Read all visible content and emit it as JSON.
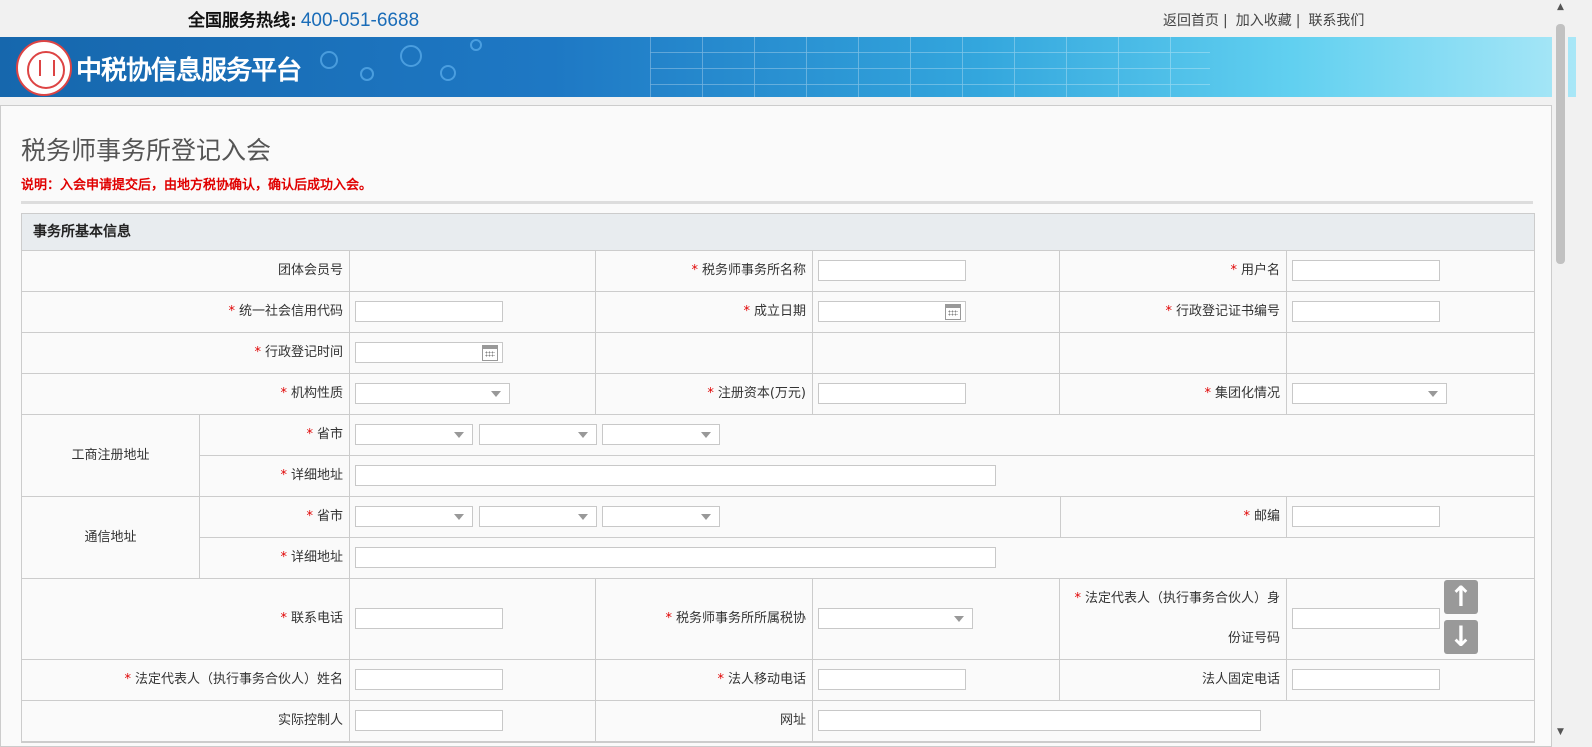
{
  "header": {
    "hotline_label": "全国服务热线:",
    "hotline_number": "400-051-6688",
    "links": [
      "返回首页",
      "加入收藏",
      "联系我们"
    ],
    "link_sep": "|",
    "brand": "中税协信息服务平台"
  },
  "page": {
    "title": "税务师事务所登记入会",
    "note": "说明：入会申请提交后，由地方税协确认，确认后成功入会。",
    "section": "事务所基本信息"
  },
  "form": {
    "member_no": "团体会员号",
    "firm_name": "税务师事务所名称",
    "username": "用户名",
    "credit_code": "统一社会信用代码",
    "founded_date": "成立日期",
    "admin_cert_no": "行政登记证书编号",
    "admin_reg_time": "行政登记时间",
    "org_nature": "机构性质",
    "reg_capital": "注册资本(万元)",
    "group_status": "集团化情况",
    "biz_address": "工商注册地址",
    "province_city": "省市",
    "detail_address": "详细地址",
    "mail_address": "通信地址",
    "postcode": "邮编",
    "phone": "联系电话",
    "tax_assoc": "税务师事务所所属税协",
    "legal_id_line1": "法定代表人（执行事务合伙人）身",
    "legal_id_line2": "份证号码",
    "legal_name": "法定代表人（执行事务合伙人）姓名",
    "legal_mobile": "法人移动电话",
    "legal_landline": "法人固定电话",
    "controller": "实际控制人",
    "website": "网址",
    "required_mark": "*"
  }
}
